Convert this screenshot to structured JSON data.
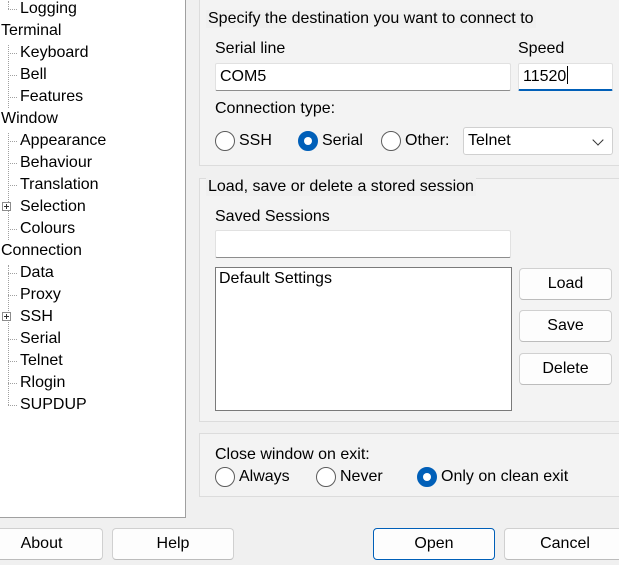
{
  "tree": {
    "items": [
      {
        "label": "Logging",
        "level": 1
      },
      {
        "label": "Terminal",
        "level": 0
      },
      {
        "label": "Keyboard",
        "level": 1
      },
      {
        "label": "Bell",
        "level": 1
      },
      {
        "label": "Features",
        "level": 1
      },
      {
        "label": "Window",
        "level": 0
      },
      {
        "label": "Appearance",
        "level": 1
      },
      {
        "label": "Behaviour",
        "level": 1
      },
      {
        "label": "Translation",
        "level": 1
      },
      {
        "label": "Selection",
        "level": 1,
        "expandable": true
      },
      {
        "label": "Colours",
        "level": 1
      },
      {
        "label": "Connection",
        "level": 0
      },
      {
        "label": "Data",
        "level": 1
      },
      {
        "label": "Proxy",
        "level": 1
      },
      {
        "label": "SSH",
        "level": 1,
        "expandable": true
      },
      {
        "label": "Serial",
        "level": 1
      },
      {
        "label": "Telnet",
        "level": 1
      },
      {
        "label": "Rlogin",
        "level": 1
      },
      {
        "label": "SUPDUP",
        "level": 1
      }
    ]
  },
  "destination": {
    "legend": "Specify the destination you want to connect to",
    "serial_line_label": "Serial line",
    "serial_line_value": "COM5",
    "speed_label": "Speed",
    "speed_value": "11520",
    "connection_type_label": "Connection type:",
    "radio_ssh": "SSH",
    "radio_serial": "Serial",
    "radio_other": "Other:",
    "selected_type": "Serial",
    "other_protocol": "Telnet"
  },
  "sessions": {
    "legend": "Load, save or delete a stored session",
    "saved_label": "Saved Sessions",
    "saved_value": "",
    "list": [
      "Default Settings"
    ],
    "load_label": "Load",
    "save_label": "Save",
    "delete_label": "Delete"
  },
  "close": {
    "label": "Close window on exit:",
    "always": "Always",
    "never": "Never",
    "clean": "Only on clean exit",
    "selected": "Only on clean exit"
  },
  "footer": {
    "about": "About",
    "help": "Help",
    "open": "Open",
    "cancel": "Cancel"
  },
  "colors": {
    "accent": "#005fb8",
    "panel_bg": "#f0f0f0",
    "tree_bg": "#ffffff"
  }
}
